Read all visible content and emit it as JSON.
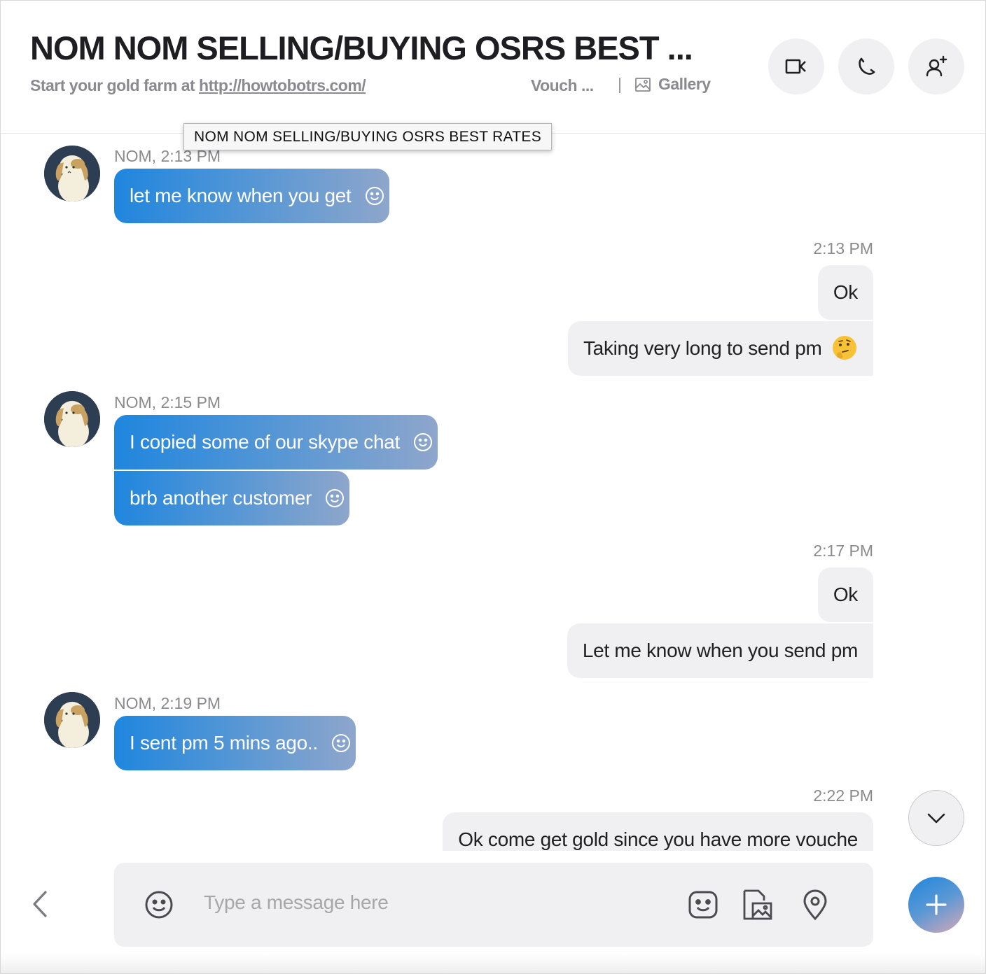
{
  "header": {
    "title": "NOM NOM SELLING/BUYING OSRS BEST ...",
    "subtitle_prefix": "Start your gold farm at ",
    "subtitle_link": "http://howtobotrs.com/",
    "vouch": "Vouch ...",
    "gallery": "Gallery",
    "buttons": [
      "video-call",
      "audio-call",
      "add-person"
    ]
  },
  "tooltip": "NOM NOM SELLING/BUYING OSRS BEST RATES",
  "messages": {
    "g1": {
      "sender": "NOM, 2:13 PM",
      "texts": [
        "let me know when you get"
      ]
    },
    "o1": {
      "time": "2:13 PM",
      "texts": [
        "Ok",
        "Taking very long to send pm"
      ],
      "emoji": "thinking-face"
    },
    "g2": {
      "sender": "NOM, 2:15 PM",
      "texts": [
        "I copied some of our skype chat",
        "brb another customer"
      ]
    },
    "o2": {
      "time": "2:17 PM",
      "texts": [
        "Ok",
        "Let me know when you send pm"
      ]
    },
    "g3": {
      "sender": "NOM, 2:19 PM",
      "texts": [
        "I sent pm 5 mins ago.."
      ]
    },
    "o3": {
      "time": "2:22 PM",
      "texts": [
        "Ok come get gold since you have more vouche"
      ]
    }
  },
  "composer": {
    "placeholder": "Type a message here",
    "value": ""
  },
  "colors": {
    "incoming_start": "#1f86de",
    "incoming_end": "#8ea6cb",
    "outgoing_bg": "#f0f0f2",
    "muted_text": "#8a8a8f"
  }
}
